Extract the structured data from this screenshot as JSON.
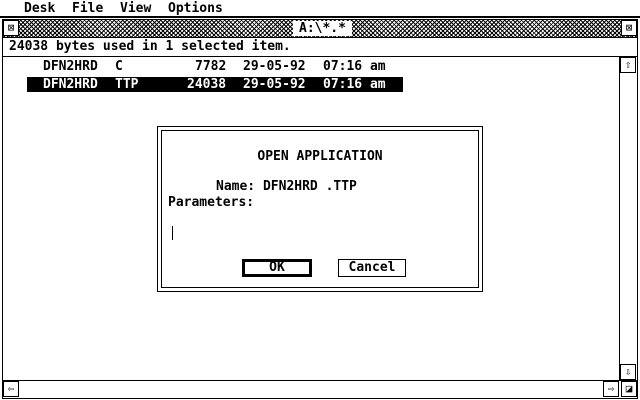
{
  "menubar": {
    "items": [
      "Desk",
      "File",
      "View",
      "Options"
    ]
  },
  "window": {
    "title": "A:\\*.*",
    "close_glyph": "⊠",
    "fuller_glyph": "⊠",
    "info": "24038 bytes used in 1 selected item."
  },
  "files": [
    {
      "name": "DFN2HRD",
      "ext": "C",
      "size": "7782",
      "date": "29-05-92",
      "time": "07:16 am",
      "selected": false
    },
    {
      "name": "DFN2HRD",
      "ext": "TTP",
      "size": "24038",
      "date": "29-05-92",
      "time": "07:16 am",
      "selected": true
    }
  ],
  "scrollbars": {
    "up": "⇧",
    "down": "⇩",
    "left": "⇦",
    "right": "⇨",
    "size": "◪"
  },
  "dialog": {
    "title": "OPEN APPLICATION",
    "name_label": "Name: DFN2HRD .TTP",
    "params_label": "Parameters:",
    "param_field": "-----------------------------------------",
    "ok_label": "OK",
    "cancel_label": "Cancel"
  }
}
